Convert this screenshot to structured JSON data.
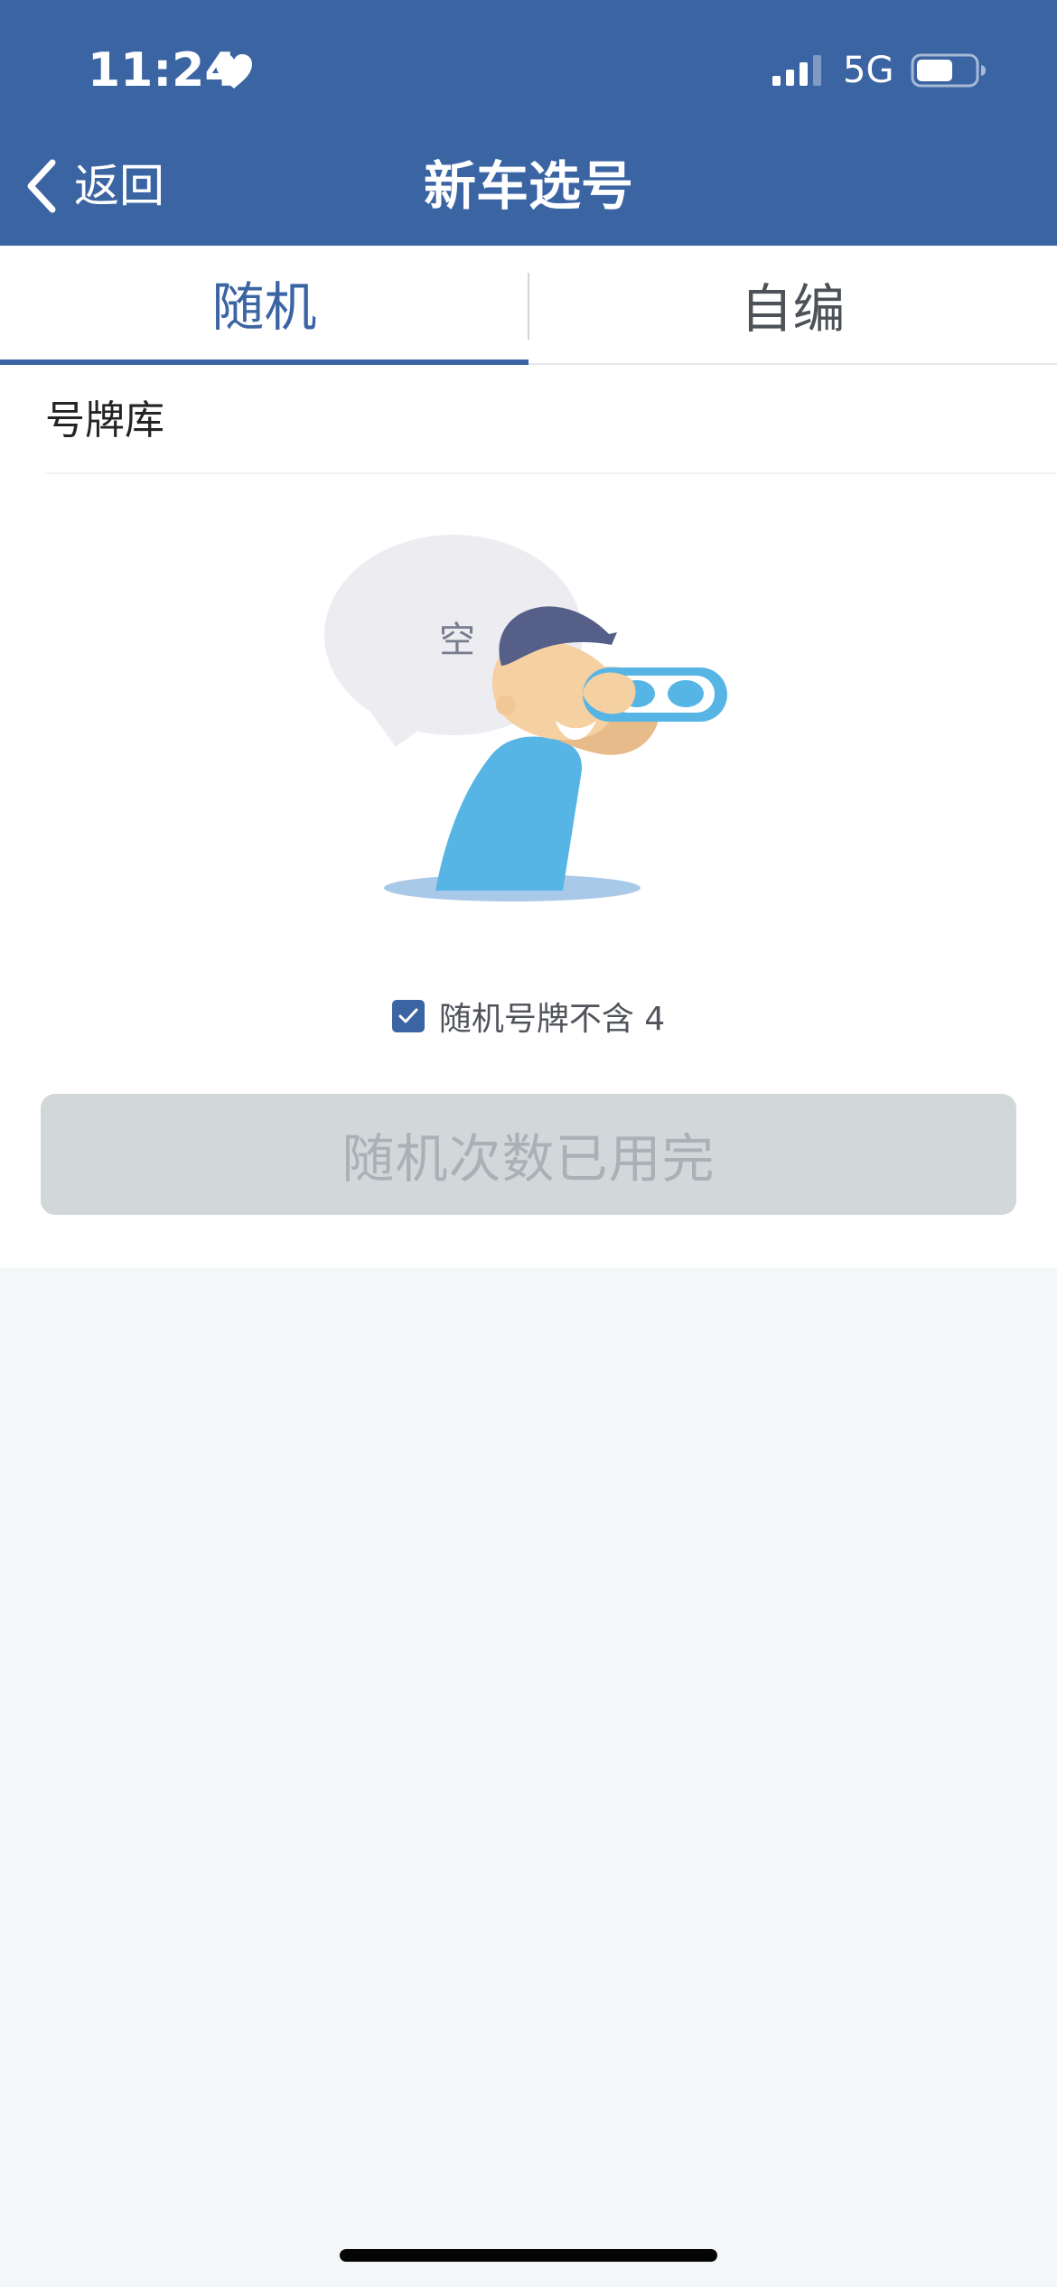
{
  "status_bar": {
    "time": "11:24",
    "network": "5G",
    "icons": {
      "heart": "heart-icon",
      "signal": "signal-bars-icon",
      "battery": "battery-icon"
    }
  },
  "navigation": {
    "back_label": "返回",
    "title": "新车选号",
    "back_icon": "chevron-left-icon"
  },
  "tabs": [
    {
      "label": "随机",
      "active": true
    },
    {
      "label": "自编",
      "active": false
    }
  ],
  "plate_library": {
    "label": "号牌库",
    "empty_text": "空",
    "illustration": "person-with-binoculars-empty-state-illustration"
  },
  "options": {
    "exclude_four_label": "随机号牌不含 4",
    "exclude_four_checked": true
  },
  "actions": {
    "random_button_label": "随机次数已用完",
    "random_button_disabled": true
  },
  "colors": {
    "primary": "#3b64a3",
    "surface": "#ffffff",
    "page_background": "#f4f7f8",
    "disabled_button": "#d2d8da",
    "disabled_text": "#aab0b5",
    "illustration_blue": "#56b5e5",
    "illustration_navy": "#555f88"
  }
}
